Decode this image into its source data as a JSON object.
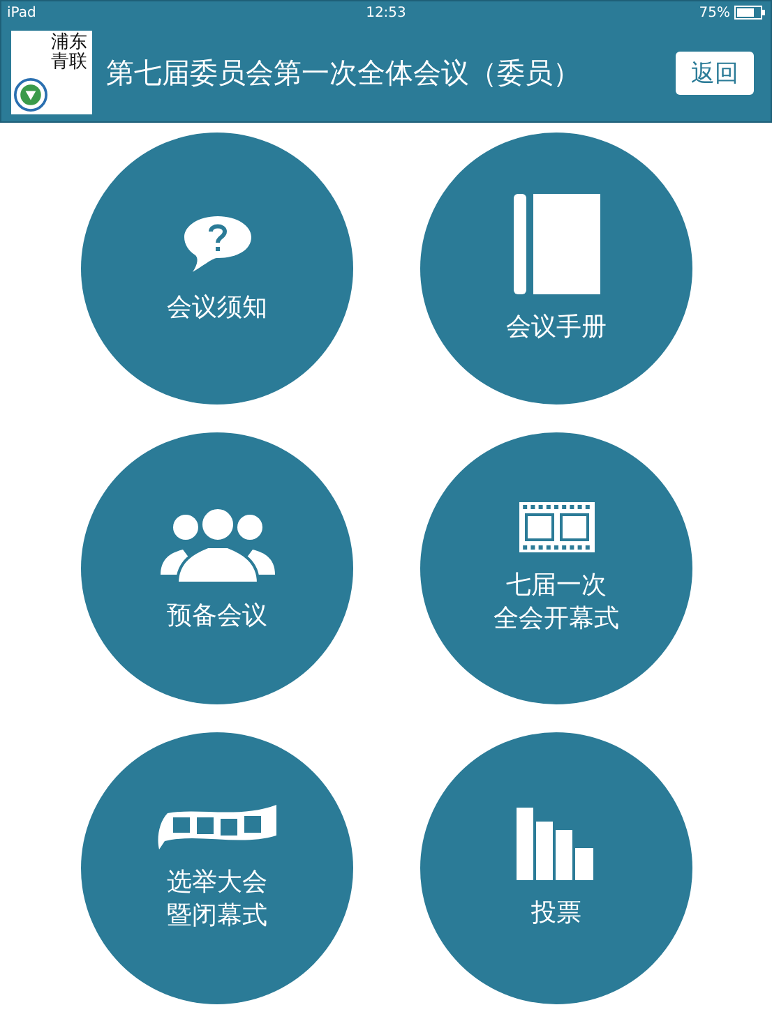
{
  "status_bar": {
    "device": "iPad",
    "time": "12:53",
    "battery": "75%"
  },
  "header": {
    "logo_text": "浦东青联",
    "title": "第七届委员会第一次全体会议（委员）",
    "back_button": "返回"
  },
  "tiles": [
    {
      "kind": "question",
      "lines": [
        "会议须知"
      ]
    },
    {
      "kind": "book",
      "lines": [
        "会议手册"
      ]
    },
    {
      "kind": "people",
      "lines": [
        "预备会议"
      ]
    },
    {
      "kind": "film",
      "lines": [
        "七届一次",
        "全会开幕式"
      ]
    },
    {
      "kind": "filmstrip",
      "lines": [
        "选举大会",
        "暨闭幕式"
      ]
    },
    {
      "kind": "bars",
      "lines": [
        "投票"
      ]
    }
  ]
}
